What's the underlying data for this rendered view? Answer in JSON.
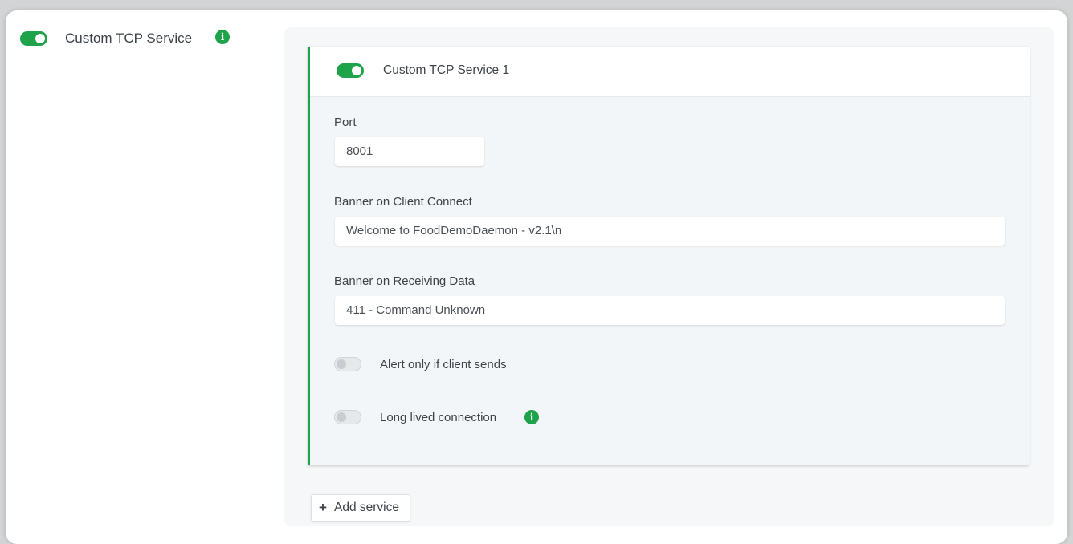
{
  "service_section": {
    "title": "Custom TCP Service",
    "enabled": true
  },
  "services": [
    {
      "title": "Custom TCP Service 1",
      "enabled": true,
      "port_label": "Port",
      "port_value": "8001",
      "banner_connect_label": "Banner on Client Connect",
      "banner_connect_value": "Welcome to FoodDemoDaemon - v2.1\\n",
      "banner_receive_label": "Banner on Receiving Data",
      "banner_receive_value": "411 - Command Unknown",
      "alert_only_label": "Alert only if client sends",
      "alert_only_enabled": false,
      "long_lived_label": "Long lived connection",
      "long_lived_enabled": false
    }
  ],
  "add_service": {
    "icon": "+",
    "label": "Add service"
  },
  "colors": {
    "accent": "#1ea34a",
    "panel_bg": "#f5f7f8",
    "text": "#3d4349"
  },
  "icons": {
    "info": "i"
  }
}
